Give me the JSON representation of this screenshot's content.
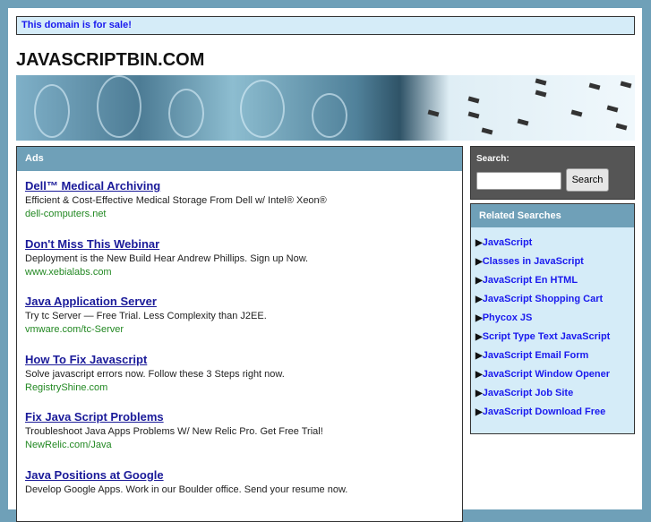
{
  "sale_notice": "This domain is for sale!",
  "site_title": "JAVASCRIPTBIN.COM",
  "ads": {
    "header": "Ads",
    "items": [
      {
        "title": "Dell™ Medical Archiving",
        "desc": "Efficient & Cost-Effective Medical Storage From Dell w/ Intel® Xeon®",
        "url": "dell-computers.net"
      },
      {
        "title": "Don't Miss This Webinar",
        "desc": "Deployment is the New Build Hear Andrew Phillips. Sign up Now.",
        "url": "www.xebialabs.com"
      },
      {
        "title": "Java Application Server",
        "desc": "Try tc Server — Free Trial. Less Complexity than J2EE.",
        "url": "vmware.com/tc-Server"
      },
      {
        "title": "How To Fix Javascript",
        "desc": "Solve javascript errors now. Follow these 3 Steps right now.",
        "url": "RegistryShine.com"
      },
      {
        "title": "Fix Java Script Problems",
        "desc": "Troubleshoot Java Apps Problems W/ New Relic Pro. Get Free Trial!",
        "url": "NewRelic.com/Java"
      },
      {
        "title": "Java Positions at Google",
        "desc": "Develop Google Apps. Work in our Boulder office. Send your resume now.",
        "url": ""
      }
    ]
  },
  "search": {
    "label": "Search:",
    "button": "Search",
    "value": ""
  },
  "related": {
    "header": "Related Searches",
    "items": [
      "JavaScript",
      "Classes in JavaScript",
      "JavaScript En HTML",
      "JavaScript Shopping Cart",
      "Phycox JS",
      "Script Type Text JavaScript",
      "JavaScript Email Form",
      "JavaScript Window Opener",
      "JavaScript Job Site",
      "JavaScript Download Free"
    ]
  }
}
